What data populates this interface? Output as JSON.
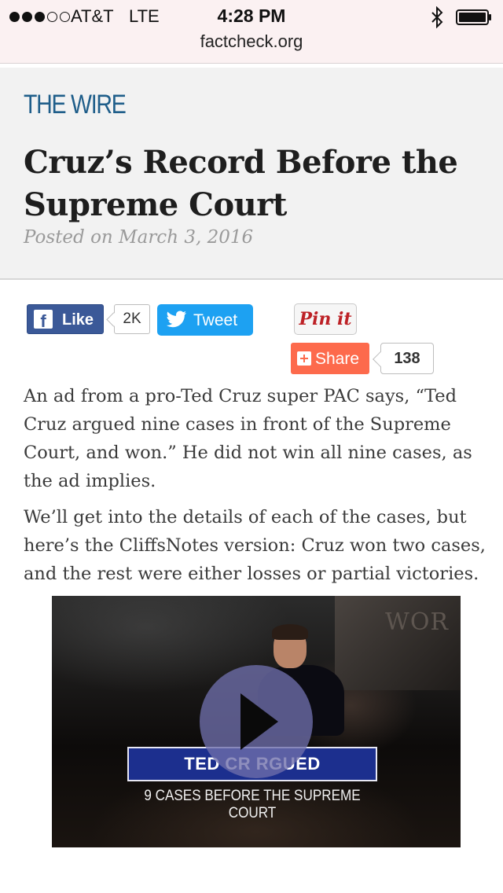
{
  "status_bar": {
    "carrier": "AT&T",
    "network": "LTE",
    "time": "4:28 PM",
    "signal_bars": 3,
    "signal_total": 5
  },
  "browser": {
    "url": "factcheck.org"
  },
  "article": {
    "section": "THE WIRE",
    "title": "Cruz’s Record Before the Supreme Court",
    "posted": "Posted on March 3, 2016",
    "paragraphs": [
      "An ad from a pro-Ted Cruz super PAC says, “Ted Cruz argued nine cases in front of the Supreme Court, and won.” He did not win all nine cases, as the ad implies.",
      "We’ll get into the details of each of the cases, but here’s the CliffsNotes version: Cruz won two cases, and the rest were either losses or partial victories."
    ]
  },
  "social": {
    "like_label": "Like",
    "like_count": "2K",
    "tweet_label": "Tweet",
    "pinit_label": "Pin it",
    "share_label": "Share",
    "share_count": "138"
  },
  "video": {
    "banner": "TED CR   RGUED",
    "subtitle": "9 CASES BEFORE THE SUPREME COURT",
    "wall_text": "WOR"
  },
  "colors": {
    "section": "#1f5e8a",
    "facebook": "#3b5998",
    "twitter": "#1da1f2",
    "pinterest": "#bd2126",
    "share": "#fd6a4c"
  }
}
